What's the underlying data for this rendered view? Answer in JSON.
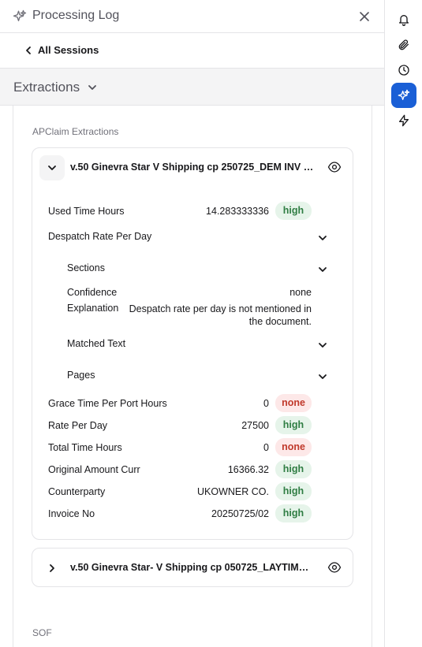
{
  "header": {
    "title": "Processing Log",
    "icon": "sparkle-icon",
    "close_icon": "close-icon"
  },
  "nav": {
    "back_label": "All Sessions",
    "back_icon": "chevron-left-icon"
  },
  "section": {
    "label": "Extractions",
    "icon": "chevron-down-icon"
  },
  "groups": [
    {
      "label": "APClaim Extractions"
    },
    {
      "label": "SOF"
    }
  ],
  "cards": [
    {
      "title": "v.50 Ginevra Star V Shipping cp 250725_DEM INV (...",
      "expanded": true,
      "rows_top": [
        {
          "key": "Used Time Hours",
          "value": "14.283333336",
          "badge": "high"
        }
      ],
      "despatch": {
        "label": "Despatch Rate Per Day",
        "sections_label": "Sections",
        "confidence_key": "Confidence",
        "confidence_value": "none",
        "explanation_key": "Explanation",
        "explanation_value": "Despatch rate per day is not mentioned in the document.",
        "matched_text_label": "Matched Text",
        "pages_label": "Pages"
      },
      "rows_bottom": [
        {
          "key": "Grace Time Per Port Hours",
          "value": "0",
          "badge": "none"
        },
        {
          "key": "Rate Per Day",
          "value": "27500",
          "badge": "high"
        },
        {
          "key": "Total Time Hours",
          "value": "0",
          "badge": "none"
        },
        {
          "key": "Original Amount Curr",
          "value": "16366.32",
          "badge": "high"
        },
        {
          "key": "Counterparty",
          "value": "UKOWNER CO.",
          "badge": "high"
        },
        {
          "key": "Invoice No",
          "value": "20250725/02",
          "badge": "high"
        }
      ]
    },
    {
      "title": "v.50 Ginevra Star- V Shipping cp 050725_LAYTIME....",
      "expanded": false
    }
  ],
  "rail": [
    {
      "icon": "bell-icon",
      "active": false
    },
    {
      "icon": "paperclip-icon",
      "active": false
    },
    {
      "icon": "clock-icon",
      "active": false
    },
    {
      "icon": "sparkle-icon",
      "active": true
    },
    {
      "icon": "lightning-icon",
      "active": false
    }
  ],
  "colors": {
    "accent": "#1a5fd6",
    "high_bg": "#e6f4ea",
    "high_fg": "#2f7d43",
    "none_bg": "#fde8e8",
    "none_fg": "#c0392b"
  }
}
